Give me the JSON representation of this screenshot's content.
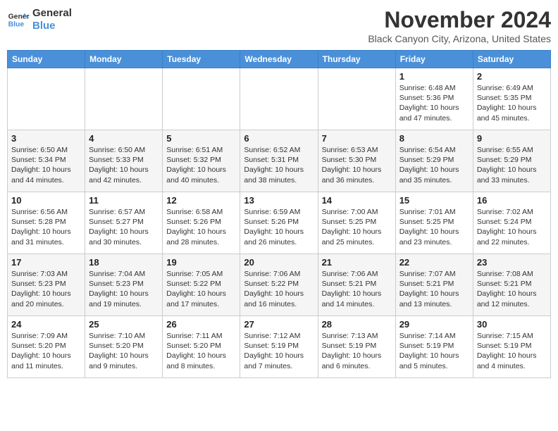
{
  "logo": {
    "line1": "General",
    "line2": "Blue"
  },
  "title": "November 2024",
  "location": "Black Canyon City, Arizona, United States",
  "days_header": [
    "Sunday",
    "Monday",
    "Tuesday",
    "Wednesday",
    "Thursday",
    "Friday",
    "Saturday"
  ],
  "weeks": [
    [
      {
        "day": "",
        "info": ""
      },
      {
        "day": "",
        "info": ""
      },
      {
        "day": "",
        "info": ""
      },
      {
        "day": "",
        "info": ""
      },
      {
        "day": "",
        "info": ""
      },
      {
        "day": "1",
        "info": "Sunrise: 6:48 AM\nSunset: 5:36 PM\nDaylight: 10 hours and 47 minutes."
      },
      {
        "day": "2",
        "info": "Sunrise: 6:49 AM\nSunset: 5:35 PM\nDaylight: 10 hours and 45 minutes."
      }
    ],
    [
      {
        "day": "3",
        "info": "Sunrise: 6:50 AM\nSunset: 5:34 PM\nDaylight: 10 hours and 44 minutes."
      },
      {
        "day": "4",
        "info": "Sunrise: 6:50 AM\nSunset: 5:33 PM\nDaylight: 10 hours and 42 minutes."
      },
      {
        "day": "5",
        "info": "Sunrise: 6:51 AM\nSunset: 5:32 PM\nDaylight: 10 hours and 40 minutes."
      },
      {
        "day": "6",
        "info": "Sunrise: 6:52 AM\nSunset: 5:31 PM\nDaylight: 10 hours and 38 minutes."
      },
      {
        "day": "7",
        "info": "Sunrise: 6:53 AM\nSunset: 5:30 PM\nDaylight: 10 hours and 36 minutes."
      },
      {
        "day": "8",
        "info": "Sunrise: 6:54 AM\nSunset: 5:29 PM\nDaylight: 10 hours and 35 minutes."
      },
      {
        "day": "9",
        "info": "Sunrise: 6:55 AM\nSunset: 5:29 PM\nDaylight: 10 hours and 33 minutes."
      }
    ],
    [
      {
        "day": "10",
        "info": "Sunrise: 6:56 AM\nSunset: 5:28 PM\nDaylight: 10 hours and 31 minutes."
      },
      {
        "day": "11",
        "info": "Sunrise: 6:57 AM\nSunset: 5:27 PM\nDaylight: 10 hours and 30 minutes."
      },
      {
        "day": "12",
        "info": "Sunrise: 6:58 AM\nSunset: 5:26 PM\nDaylight: 10 hours and 28 minutes."
      },
      {
        "day": "13",
        "info": "Sunrise: 6:59 AM\nSunset: 5:26 PM\nDaylight: 10 hours and 26 minutes."
      },
      {
        "day": "14",
        "info": "Sunrise: 7:00 AM\nSunset: 5:25 PM\nDaylight: 10 hours and 25 minutes."
      },
      {
        "day": "15",
        "info": "Sunrise: 7:01 AM\nSunset: 5:25 PM\nDaylight: 10 hours and 23 minutes."
      },
      {
        "day": "16",
        "info": "Sunrise: 7:02 AM\nSunset: 5:24 PM\nDaylight: 10 hours and 22 minutes."
      }
    ],
    [
      {
        "day": "17",
        "info": "Sunrise: 7:03 AM\nSunset: 5:23 PM\nDaylight: 10 hours and 20 minutes."
      },
      {
        "day": "18",
        "info": "Sunrise: 7:04 AM\nSunset: 5:23 PM\nDaylight: 10 hours and 19 minutes."
      },
      {
        "day": "19",
        "info": "Sunrise: 7:05 AM\nSunset: 5:22 PM\nDaylight: 10 hours and 17 minutes."
      },
      {
        "day": "20",
        "info": "Sunrise: 7:06 AM\nSunset: 5:22 PM\nDaylight: 10 hours and 16 minutes."
      },
      {
        "day": "21",
        "info": "Sunrise: 7:06 AM\nSunset: 5:21 PM\nDaylight: 10 hours and 14 minutes."
      },
      {
        "day": "22",
        "info": "Sunrise: 7:07 AM\nSunset: 5:21 PM\nDaylight: 10 hours and 13 minutes."
      },
      {
        "day": "23",
        "info": "Sunrise: 7:08 AM\nSunset: 5:21 PM\nDaylight: 10 hours and 12 minutes."
      }
    ],
    [
      {
        "day": "24",
        "info": "Sunrise: 7:09 AM\nSunset: 5:20 PM\nDaylight: 10 hours and 11 minutes."
      },
      {
        "day": "25",
        "info": "Sunrise: 7:10 AM\nSunset: 5:20 PM\nDaylight: 10 hours and 9 minutes."
      },
      {
        "day": "26",
        "info": "Sunrise: 7:11 AM\nSunset: 5:20 PM\nDaylight: 10 hours and 8 minutes."
      },
      {
        "day": "27",
        "info": "Sunrise: 7:12 AM\nSunset: 5:19 PM\nDaylight: 10 hours and 7 minutes."
      },
      {
        "day": "28",
        "info": "Sunrise: 7:13 AM\nSunset: 5:19 PM\nDaylight: 10 hours and 6 minutes."
      },
      {
        "day": "29",
        "info": "Sunrise: 7:14 AM\nSunset: 5:19 PM\nDaylight: 10 hours and 5 minutes."
      },
      {
        "day": "30",
        "info": "Sunrise: 7:15 AM\nSunset: 5:19 PM\nDaylight: 10 hours and 4 minutes."
      }
    ]
  ]
}
